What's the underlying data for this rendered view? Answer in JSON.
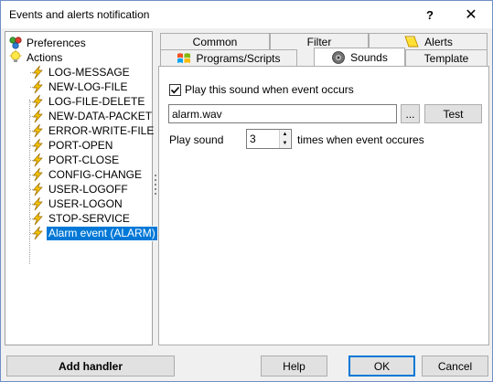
{
  "window": {
    "title": "Events and alerts notification",
    "help_glyph": "?",
    "close_glyph": "✕"
  },
  "tree": {
    "preferences": "Preferences",
    "actions": "Actions",
    "items": [
      "LOG-MESSAGE",
      "NEW-LOG-FILE",
      "LOG-FILE-DELETE",
      "NEW-DATA-PACKET",
      "ERROR-WRITE-FILE",
      "PORT-OPEN",
      "PORT-CLOSE",
      "CONFIG-CHANGE",
      "USER-LOGOFF",
      "USER-LOGON",
      "STOP-SERVICE",
      "Alarm event (ALARM)"
    ],
    "selected": "Alarm event (ALARM)"
  },
  "tabs": {
    "row1": [
      "Common",
      "Filter",
      "Alerts"
    ],
    "row2": [
      "Programs/Scripts",
      "Sounds",
      "Template"
    ],
    "active": "Sounds"
  },
  "sounds": {
    "checkbox_label": "Play this sound when event occurs",
    "checkbox_checked": true,
    "file_value": "alarm.wav",
    "browse_label": "...",
    "test_label": "Test",
    "play_label": "Play sound",
    "times_value": "3",
    "times_suffix": "times when event occures"
  },
  "footer": {
    "add_handler": "Add handler",
    "help": "Help",
    "ok": "OK",
    "cancel": "Cancel"
  },
  "colors": {
    "selection": "#0078d7",
    "lightning": "#f5c400"
  }
}
